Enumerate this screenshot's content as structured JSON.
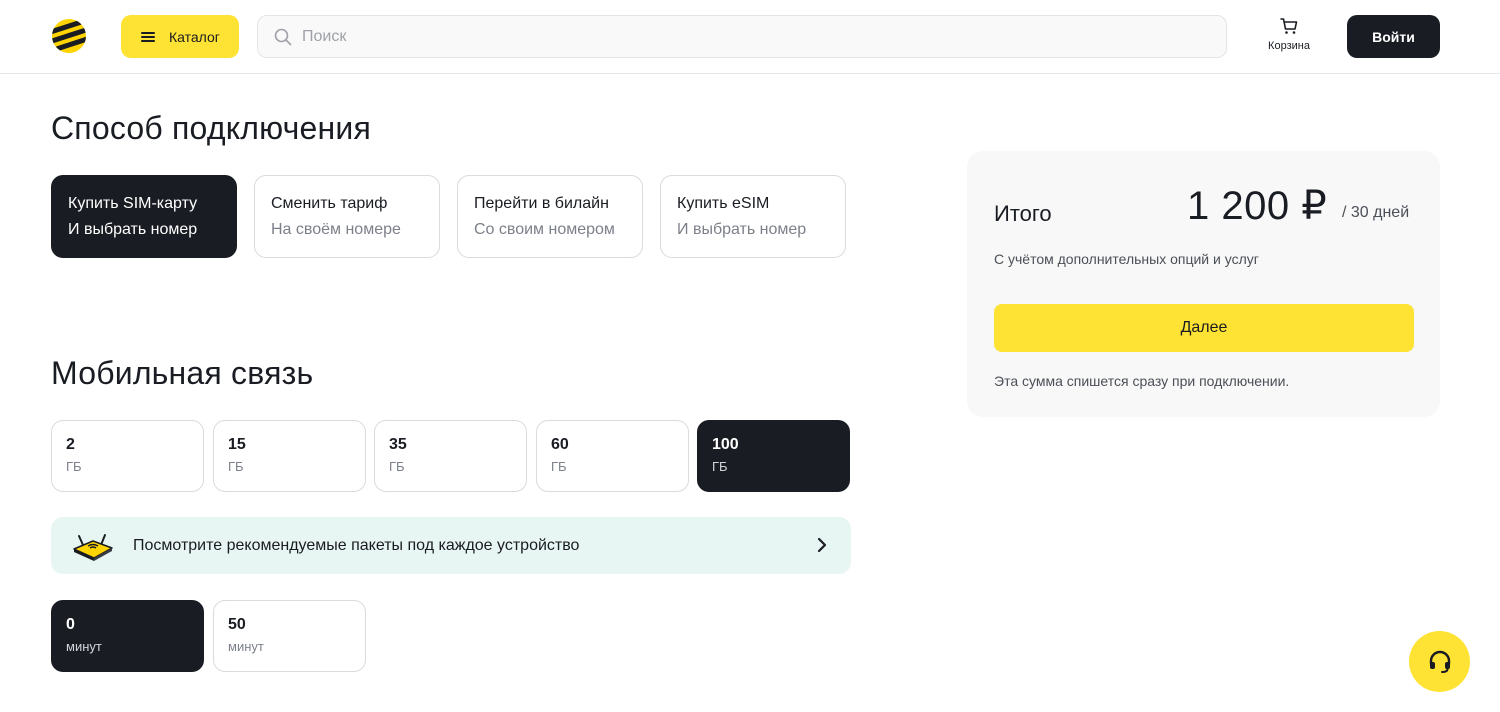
{
  "header": {
    "catalog_label": "Каталог",
    "search_placeholder": "Поиск",
    "search_value": "",
    "cart_label": "Корзина",
    "login_label": "Войти"
  },
  "connection": {
    "title": "Способ подключения",
    "options": [
      {
        "line1": "Купить SIM-карту",
        "line2": "И выбрать номер",
        "selected": true
      },
      {
        "line1": "Сменить тариф",
        "line2": "На своём номере",
        "selected": false
      },
      {
        "line1": "Перейти в билайн",
        "line2": "Со своим номером",
        "selected": false
      },
      {
        "line1": "Купить eSIM",
        "line2": "И выбрать номер",
        "selected": false
      }
    ]
  },
  "mobile": {
    "title": "Мобильная связь",
    "data_options": [
      {
        "value": "2",
        "unit": "ГБ",
        "selected": false
      },
      {
        "value": "15",
        "unit": "ГБ",
        "selected": false
      },
      {
        "value": "35",
        "unit": "ГБ",
        "selected": false
      },
      {
        "value": "60",
        "unit": "ГБ",
        "selected": false
      },
      {
        "value": "100",
        "unit": "ГБ",
        "selected": true
      }
    ],
    "banner_text": "Посмотрите рекомендуемые пакеты под каждое устройство",
    "minute_options": [
      {
        "value": "0",
        "unit": "минут",
        "selected": true
      },
      {
        "value": "50",
        "unit": "минут",
        "selected": false
      }
    ]
  },
  "summary": {
    "total_label": "Итого",
    "price": "1 200 ₽",
    "period": "/ 30 дней",
    "note": "С учётом дополнительных опций и услуг",
    "next_label": "Далее",
    "footnote": "Эта сумма спишется сразу при подключении."
  },
  "colors": {
    "accent_yellow": "#ffe334",
    "dark": "#191c22",
    "banner_bg": "#e8f6f3"
  },
  "icons": {
    "logo": "beeline-logo",
    "catalog": "menu-icon",
    "search": "search-icon",
    "cart": "cart-icon",
    "banner": "router-icon",
    "banner_arrow": "chevron-right-icon",
    "support": "headset-icon"
  }
}
